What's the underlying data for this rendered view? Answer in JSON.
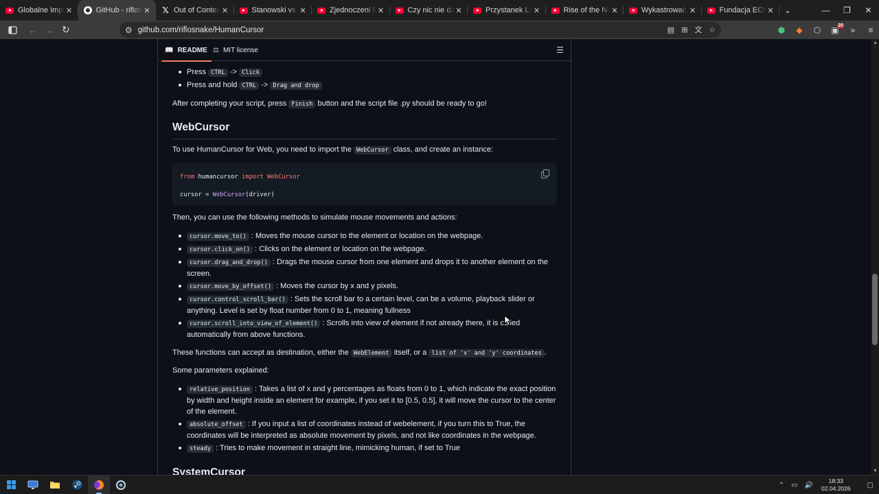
{
  "browser": {
    "tabs": [
      {
        "title": "Globalne Imperium B",
        "icon": "youtube-icon",
        "active": false
      },
      {
        "title": "GitHub - riflosnake/H",
        "icon": "github-icon",
        "active": true
      },
      {
        "title": "Out of Context Polish",
        "icon": "x-icon",
        "active": false
      },
      {
        "title": "Stanowski vs Wojewó",
        "icon": "youtube-icon",
        "active": false
      },
      {
        "title": "Zjednoczeni Przeciw",
        "icon": "youtube-icon",
        "active": false
      },
      {
        "title": "Czy nic nie dzieje się",
        "icon": "youtube-icon",
        "active": false
      },
      {
        "title": "Przystanek Lombard",
        "icon": "youtube-icon",
        "active": false
      },
      {
        "title": "Rise of the Nazis and",
        "icon": "youtube-icon",
        "active": false
      },
      {
        "title": "Wykastrować bezdom",
        "icon": "youtube-icon",
        "active": false
      },
      {
        "title": "Fundacja ECPU Polsk",
        "icon": "youtube-icon",
        "active": false
      }
    ],
    "close_glyph": "✕",
    "address": {
      "url": "github.com/riflosnake/HumanCursor"
    },
    "extension_badge": "20"
  },
  "readme": {
    "tab_readme": "README",
    "tab_license": "MIT license",
    "list_top": [
      {
        "prefix": "Press",
        "code1": "CTRL",
        "arrow": "->",
        "code2": "Click"
      },
      {
        "prefix": "Press and hold",
        "code1": "CTRL",
        "arrow": "->",
        "code2": "Drag and drop"
      }
    ],
    "after_script": {
      "pre": "After completing your script, press",
      "code": "Finish",
      "post": "button and the script file .py should be ready to go!"
    },
    "webcursor_heading": "WebCursor",
    "import_para": {
      "pre": "To use HumanCursor for Web, you need to import the",
      "code": "WebCursor",
      "post": "class, and create an instance:"
    },
    "codeblock": {
      "line1": {
        "kw1": "from",
        "mod": " humancursor ",
        "kw2": "import",
        "cls": " WebCursor"
      },
      "line2": {
        "var": "cursor = ",
        "cls": "WebCursor",
        "arg": "(driver)"
      }
    },
    "methods_intro": "Then, you can use the following methods to simulate mouse movements and actions:",
    "methods": [
      {
        "code": "cursor.move_to()",
        "text": ": Moves the mouse cursor to the element or location on the webpage."
      },
      {
        "code": "cursor.click_on()",
        "text": ": Clicks on the element or location on the webpage."
      },
      {
        "code": "cursor.drag_and_drop()",
        "text": ": Drags the mouse cursor from one element and drops it to another element on the screen."
      },
      {
        "code": "cursor.move_by_offset()",
        "text": ": Moves the cursor by x and y pixels."
      },
      {
        "code": "cursor.control_scroll_bar()",
        "text": ": Sets the scroll bar to a certain level, can be a volume, playback slider or anything. Level is set by float number from 0 to 1, meaning fullness"
      },
      {
        "code": "cursor.scroll_into_view_of_element()",
        "text": ": Scrolls into view of element if not already there, it is called automatically from above functions."
      }
    ],
    "destination_para": {
      "pre": "These functions can accept as destination, either the",
      "code1": "WebElement",
      "mid": "itself, or a",
      "code2": "list of 'x' and 'y' coordinates",
      "post": "."
    },
    "params_intro": "Some parameters explained:",
    "params": [
      {
        "code": "relative_position",
        "text": ": Takes a list of x and y percentages as floats from 0 to 1, which indicate the exact position by width and height inside an element for example, if you set it to [0.5, 0.5], it will move the cursor to the center of the element."
      },
      {
        "code": "absolute_offset",
        "text": ": If you input a list of coordinates instead of webelement, if you turn this to True, the coordinates will be interpreted as absolute movement by pixels, and not like coordinates in the webpage."
      },
      {
        "code": "steady",
        "text": ": Tries to make movement in straight line, mimicking human, if set to True"
      }
    ],
    "systemcursor_heading": "SystemCursor"
  },
  "taskbar": {
    "clock_time": "18:33",
    "clock_date": "02.04.2026"
  },
  "colors": {
    "page_bg": "#0d1117",
    "accent_tab_underline": "#f78166",
    "code_keyword": "#ff7b72",
    "code_class": "#d2a8ff"
  }
}
